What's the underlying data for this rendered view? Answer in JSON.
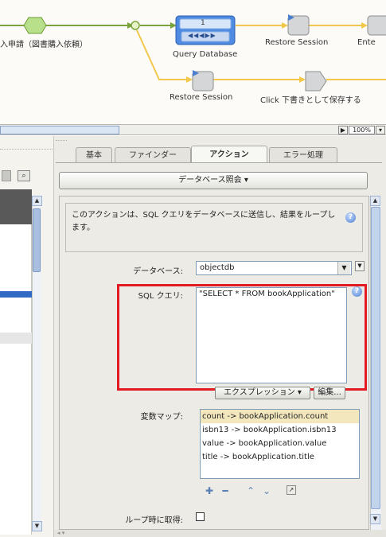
{
  "flow": {
    "nodes": [
      {
        "label": "入申請（図書購入依頼）"
      },
      {
        "label": "Query Database",
        "badge": "1"
      },
      {
        "label": "Restore Session"
      },
      {
        "label": "Ente"
      },
      {
        "label": "Restore Session"
      },
      {
        "label": "Click 下書きとして保存する"
      }
    ]
  },
  "zoom": {
    "level": "100%"
  },
  "tabs": [
    {
      "label": "基本"
    },
    {
      "label": "ファインダー"
    },
    {
      "label": "アクション"
    },
    {
      "label": "エラー処理"
    }
  ],
  "action": {
    "dropdown_label": "データベース照会 ▾",
    "description": "このアクションは、SQL クエリをデータベースに送信し、結果をループします。",
    "database_label": "データベース:",
    "database_value": "objectdb",
    "sql_label": "SQL クエリ:",
    "sql_value": "\"SELECT * FROM bookApplication\"",
    "expression_button": "エクスプレッション ▾",
    "edit_button": "編集...",
    "map_label": "変数マップ:",
    "map_items": [
      "count -> bookApplication.count",
      "isbn13 -> bookApplication.isbn13",
      "value -> bookApplication.value",
      "title -> bookApplication.title"
    ],
    "loop_label": "ループ時に取得:"
  },
  "colors": {
    "flow_line_green": "#7ba33d",
    "flow_line_yellow": "#f1c84a",
    "highlight_red": "#e21b23",
    "selection_blue": "#316ac5"
  }
}
